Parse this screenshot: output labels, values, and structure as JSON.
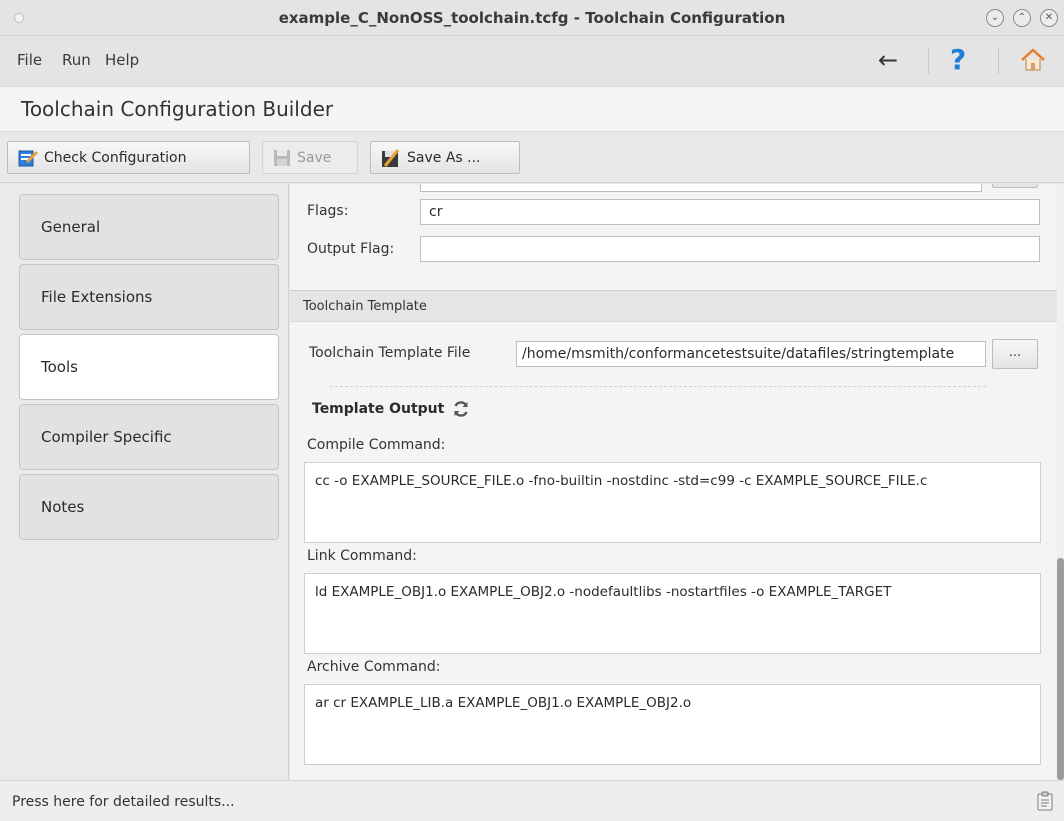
{
  "window": {
    "title": "example_C_NonOSS_toolchain.tcfg - Toolchain Configuration",
    "minimize_glyph": "⌄",
    "maximize_glyph": "⌃",
    "close_glyph": "✕"
  },
  "menu": {
    "items": [
      "File",
      "Run",
      "Help"
    ],
    "back_glyph": "←",
    "help_glyph": "?"
  },
  "app": {
    "heading": "Toolchain Configuration Builder"
  },
  "toolbar": {
    "check_label": "Check Configuration",
    "save_label": "Save",
    "save_as_label": "Save As ..."
  },
  "tabs": [
    {
      "label": "General",
      "active": false
    },
    {
      "label": "File Extensions",
      "active": false
    },
    {
      "label": "Tools",
      "active": true
    },
    {
      "label": "Compiler Specific",
      "active": false
    },
    {
      "label": "Notes",
      "active": false
    }
  ],
  "archiver": {
    "flags_label": "Flags:",
    "flags_value": "cr",
    "output_flag_label": "Output Flag:",
    "output_flag_value": ""
  },
  "template": {
    "section_title": "Toolchain Template",
    "file_label": "Toolchain Template File",
    "file_value": "/home/msmith/conformancetestsuite/datafiles/stringtemplate",
    "browse_label": "...",
    "output_heading": "Template Output",
    "compile_label": "Compile Command:",
    "compile_value": "cc -o EXAMPLE_SOURCE_FILE.o -fno-builtin -nostdinc -std=c99 -c EXAMPLE_SOURCE_FILE.c",
    "link_label": "Link Command:",
    "link_value": "ld EXAMPLE_OBJ1.o EXAMPLE_OBJ2.o -nodefaultlibs -nostartfiles -o EXAMPLE_TARGET",
    "archive_label": "Archive Command:",
    "archive_value": "ar cr EXAMPLE_LIB.a EXAMPLE_OBJ1.o EXAMPLE_OBJ2.o"
  },
  "status": {
    "text": "Press here for detailed results..."
  },
  "colors": {
    "accent_blue": "#1f7fd6",
    "home_orange": "#e87b2a"
  }
}
